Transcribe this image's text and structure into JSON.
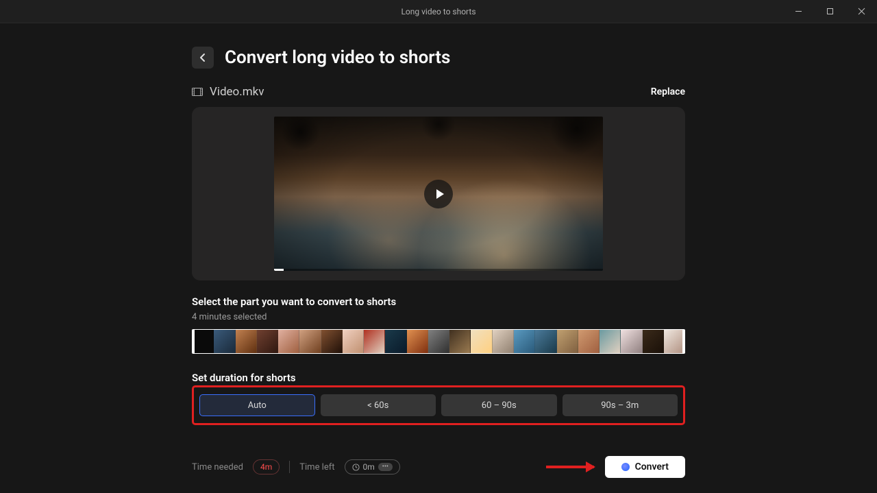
{
  "titlebar": {
    "title": "Long video to shorts"
  },
  "header": {
    "page_title": "Convert long video to shorts"
  },
  "file": {
    "name": "Video.mkv",
    "replace_label": "Replace"
  },
  "select": {
    "title": "Select the part you want to convert to shorts",
    "subtitle": "4 minutes selected"
  },
  "duration": {
    "title": "Set duration for shorts",
    "options": [
      "Auto",
      "< 60s",
      "60 – 90s",
      "90s – 3m"
    ],
    "selected_index": 0
  },
  "footer": {
    "time_needed_label": "Time needed",
    "time_needed_value": "4m",
    "time_left_label": "Time left",
    "time_left_value": "0m",
    "convert_label": "Convert"
  },
  "thumb_colors": [
    "#0a0a0a",
    "linear-gradient(135deg,#3a5a7a,#1a2a3a)",
    "linear-gradient(135deg,#c08050,#603010)",
    "linear-gradient(135deg,#704030,#301810)",
    "linear-gradient(135deg,#e0b0a0,#a06040)",
    "linear-gradient(135deg,#d0a080,#704020)",
    "linear-gradient(135deg,#805030,#201008)",
    "linear-gradient(135deg,#f0d0c0,#c09070)",
    "linear-gradient(135deg,#b03020,#e0d0c0)",
    "linear-gradient(135deg,#1a3a4a,#0a1a2a)",
    "linear-gradient(135deg,#e09050,#803010)",
    "linear-gradient(135deg,#808080,#303030)",
    "linear-gradient(135deg,#403020,#9a7a50)",
    "linear-gradient(135deg,#f0e0c0,#ffd080)",
    "linear-gradient(135deg,#e0d0c0,#908070)",
    "linear-gradient(135deg,#5a9ac0,#2a5a7a)",
    "linear-gradient(135deg,#4a7a9a,#1a3a4a)",
    "linear-gradient(135deg,#c0a070,#806040)",
    "linear-gradient(135deg,#d09a70,#a06040)",
    "linear-gradient(135deg,#6a9aa0,#e0d0c0)",
    "linear-gradient(135deg,#f0e0e0,#908080)",
    "linear-gradient(135deg,#3a2a1a,#1a1008)",
    "linear-gradient(135deg,#f0e8e0,#b09080)"
  ]
}
